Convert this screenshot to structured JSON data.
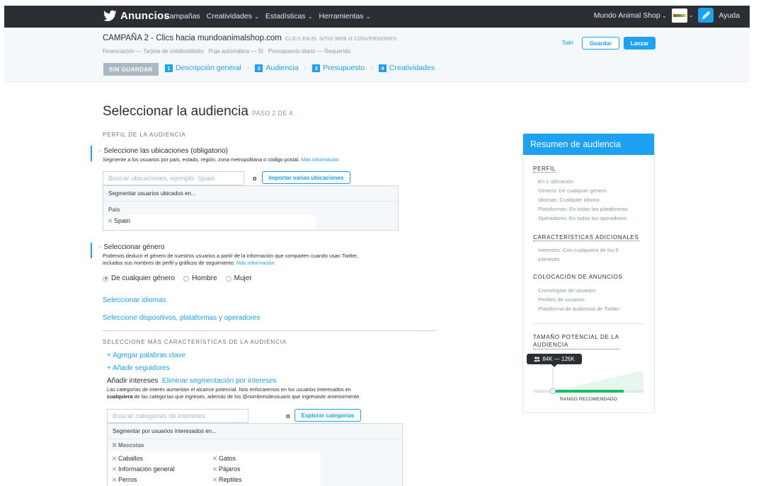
{
  "nav": {
    "brand": "Anuncios",
    "menu": [
      "Campañas",
      "Creatividades",
      "Estadísticas",
      "Herramientas"
    ],
    "menu_dropdown": [
      false,
      true,
      true,
      true
    ],
    "account": "Mundo Animal Shop",
    "help": "Ayuda"
  },
  "campaign": {
    "title": "CAMPAÑA 2 - Clics hacia mundoanimalshop.com",
    "objective": "CLICS EN EL SITIO WEB O CONVERSIONES",
    "meta": [
      "Financiación — Tarjeta de crédito/débito",
      "Puja automática — Sí",
      "Presupuesto diario — Requerido"
    ],
    "exit": "Salir",
    "save": "Guardar",
    "launch": "Lanzar",
    "unsaved": "SIN GUARDAR",
    "steps": [
      {
        "num": "1",
        "label": "Descripción general"
      },
      {
        "num": "2",
        "label": "Audiencia"
      },
      {
        "num": "3",
        "label": "Presupuesto"
      },
      {
        "num": "4",
        "label": "Creatividades"
      }
    ]
  },
  "main": {
    "title": "Seleccionar la audiencia",
    "step": "PASO 2 DE 4",
    "profile_label": "PERFIL DE LA AUDIENCIA",
    "locations": {
      "title": "Seleccione las ubicaciones (obligatorio)",
      "help": "Segmente a los usuarios por país, estado, región, zona metropolitana o código postal.",
      "more": "Más información",
      "placeholder": "Buscar ubicaciones, ejemplo: Spain",
      "or": "o",
      "import": "Importar varias ubicaciones",
      "panel_head": "Segmentar usuarios ubicados en...",
      "group": "País",
      "items": [
        "Spain"
      ]
    },
    "gender": {
      "title": "Seleccionar género",
      "help1": "Podemos deducir el género de nuestros usuarios a partir de la información que comparten cuando usan Twitter,",
      "help2": "incluidos sus nombres de perfil y gráficos de seguimiento.",
      "more": "Más información.",
      "options": [
        "De cualquier género",
        "Hombre",
        "Mujer"
      ],
      "selected": "De cualquier género"
    },
    "languages_link": "Seleccionar idiomas",
    "devices_link": "Seleccione dispositivos, plataformas y operadores",
    "more_label": "SELECCIONE MÁS CARACTERÍSTICAS DE LA AUDIENCIA",
    "add_keywords": "+ Agregar palabras clave",
    "add_followers": "+ Añadir seguidores",
    "interests": {
      "title": "Añadir intereses",
      "remove": "Eliminar segmentación por intereses",
      "help1": "Las categorías de interés aumentan el alcance potencial. Nos enfocaremos en los usuarios interesados en",
      "help2_bold": "cualquiera",
      "help2_rest": " de las categorías que ingreses, además de los @nombresdeusuario que ingresaste anteriormente.",
      "placeholder": "Buscar categorías de intereses",
      "or": "o",
      "explore": "Explorar categorías",
      "panel_head": "Segmentar por usuarios interesados en...",
      "group": "Mascotas",
      "items": [
        "Caballos",
        "Gatos",
        "Información general",
        "Pájaros",
        "Perros",
        "Reptiles"
      ]
    }
  },
  "summary": {
    "title": "Resumen de audiencia",
    "profile_title": "PERFIL",
    "profile_items": [
      "En 1 ubicación",
      "Género: De cualquier género",
      "Idiomas: Cualquier idioma",
      "Plataformas: En todas las plataformas",
      "Operadores: En todos los operadores"
    ],
    "additional_title": "CARACTERÍSTICAS ADICIONALES",
    "additional_items": [
      "Intereses: Con cualquiera de los 6",
      "intereses"
    ],
    "placement_title": "COLOCACIÓN DE ANUNCIOS",
    "placement_items": [
      "Cronologías de usuarios",
      "Perfiles de usuarios",
      "Plataforma de audiencia de Twitter"
    ],
    "size_title_1": "TAMAÑO POTENCIAL DE LA",
    "size_title_2": "AUDIENCIA",
    "size_range": "84K — 126K",
    "range_label": "RANGO RECOMENDADO"
  },
  "colors": {
    "accent": "#1da1f2",
    "nav_bg": "#2b2f33",
    "green": "#17bf63"
  }
}
